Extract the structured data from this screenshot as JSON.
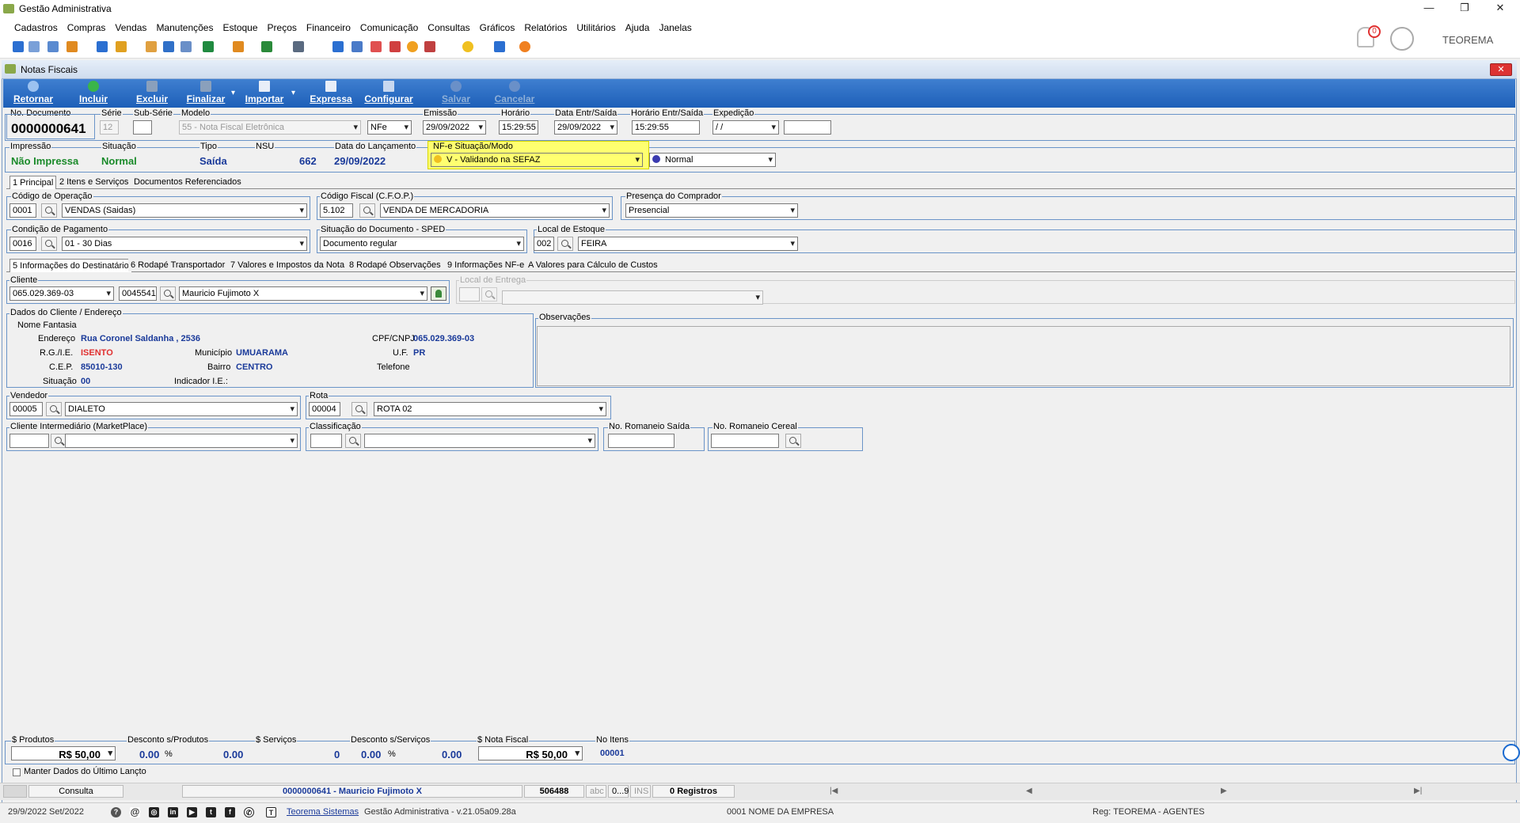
{
  "app": {
    "title": "Gestão Administrativa",
    "min": "—",
    "restore": "❐",
    "close": "✕"
  },
  "menu": [
    "Cadastros",
    "Compras",
    "Vendas",
    "Manutenções",
    "Estoque",
    "Preços",
    "Financeiro",
    "Comunicação",
    "Consultas",
    "Gráficos",
    "Relatórios",
    "Utilitários",
    "Ajuda",
    "Janelas"
  ],
  "user": {
    "name": "TEOREMA",
    "notifications": "0"
  },
  "child": {
    "title": "Notas Fiscais",
    "close": "✕"
  },
  "toolbar": {
    "retornar": "Retornar",
    "incluir": "Incluir",
    "excluir": "Excluir",
    "finalizar": "Finalizar",
    "importar": "Importar",
    "expressa": "Expressa",
    "configurar": "Configurar",
    "salvar": "Salvar",
    "cancelar": "Cancelar"
  },
  "header": {
    "no_documento_label": "No. Documento",
    "no_documento": "0000000641",
    "serie_label": "Série",
    "serie": "12",
    "subserie_label": "Sub-Série",
    "subserie": "",
    "modelo_label": "Modelo",
    "modelo": "55 - Nota Fiscal Eletrônica",
    "modelo_tipo": "NFe",
    "emissao_label": "Emissão",
    "emissao": "29/09/2022",
    "horario_label": "Horário",
    "horario": "15:29:55",
    "data_entr_label": "Data Entr/Saída",
    "data_entr": "29/09/2022",
    "horario_entr_label": "Horário Entr/Saída",
    "horario_entr": "15:29:55",
    "expedicao_label": "Expedição",
    "expedicao": " / /",
    "expedicao_hora": ""
  },
  "status": {
    "impressao_label": "Impressão",
    "impressao": "Não Impressa",
    "situacao_label": "Situação",
    "situacao": "Normal",
    "tipo_label": "Tipo",
    "tipo": "Saída",
    "nsu_label": "NSU",
    "nsu": "662",
    "data_lanc_label": "Data do Lançamento",
    "data_lanc": "29/09/2022",
    "nfe_label": "NF-e Situação/Modo",
    "nfe_situacao": "V - Validando na SEFAZ",
    "nfe_modo": "Normal"
  },
  "tabs1": [
    "1 Principal",
    "2 Itens e Serviços",
    "Documentos Referenciados"
  ],
  "principal": {
    "cod_op_label": "Código de Operação",
    "cod_op": "0001",
    "cod_op_desc": "VENDAS (Saidas)",
    "cfop_label": "Código Fiscal (C.F.O.P.)",
    "cfop": "5.102",
    "cfop_desc": "VENDA DE MERCADORIA",
    "presenca_label": "Presença do Comprador",
    "presenca": "Presencial",
    "cond_pag_label": "Condição de Pagamento",
    "cond_pag": "0016",
    "cond_pag_desc": "01 - 30 Dias",
    "sit_doc_label": "Situação do Documento - SPED",
    "sit_doc": "Documento regular",
    "local_est_label": "Local de Estoque",
    "local_est": "002",
    "local_est_desc": "FEIRA"
  },
  "tabs2": [
    "5 Informações do Destinatário",
    "6 Rodapé Transportador",
    "7 Valores e Impostos da Nota",
    "8 Rodapé Observações",
    "9 Informações NF-e",
    "A Valores para Cálculo de Custos"
  ],
  "destinatario": {
    "cliente_label": "Cliente",
    "cpf": "065.029.369-03",
    "codigo": "0045541",
    "nome": "Mauricio Fujimoto X",
    "local_entrega_label": "Local de Entrega",
    "dados_label": "Dados do Cliente / Endereço",
    "nome_fantasia_label": "Nome Fantasia",
    "endereco_label": "Endereço",
    "endereco": "Rua Coronel Saldanha , 2536",
    "cpfcnpj_label": "CPF/CNPJ",
    "cpfcnpj": "065.029.369-03",
    "rgie_label": "R.G./I.E.",
    "rgie": "ISENTO",
    "municipio_label": "Município",
    "municipio": "UMUARAMA",
    "uf_label": "U.F.",
    "uf": "PR",
    "cep_label": "C.E.P.",
    "cep": "85010-130",
    "bairro_label": "Bairro",
    "bairro": "CENTRO",
    "telefone_label": "Telefone",
    "situacao_label": "Situação",
    "situacao": "00",
    "indicador_label": "Indicador I.E.:",
    "observacoes_label": "Observações",
    "vendedor_label": "Vendedor",
    "vendedor": "00005",
    "vendedor_desc": "DIALETO",
    "rota_label": "Rota",
    "rota": "00004",
    "rota_desc": "ROTA 02",
    "intermediario_label": "Cliente Intermediário (MarketPlace)",
    "classificacao_label": "Classificação",
    "romaneio_saida_label": "No. Romaneio Saída",
    "romaneio_cereal_label": "No. Romaneio Cereal"
  },
  "totals": {
    "produtos_label": "$ Produtos",
    "produtos": "R$ 50,00",
    "desc_prod_label": "Desconto s/Produtos",
    "desc_prod_pct": "0.00",
    "desc_prod": "0.00",
    "servicos_label": "$ Serviços",
    "servicos": "0",
    "desc_serv_label": "Desconto s/Serviços",
    "desc_serv_pct": "0.00",
    "desc_serv": "0.00",
    "nota_label": "$ Nota Fiscal",
    "nota": "R$ 50,00",
    "itens_label": "No Itens",
    "itens": "00001",
    "pct": "%",
    "manter": "Manter Dados do Último Lançto"
  },
  "statusbar": {
    "consulta": "Consulta",
    "registro": "0000000641 - Mauricio Fujimoto X",
    "code": "506488",
    "abc": "abc",
    "num": "0...9",
    "ins": "INS",
    "registros": "0 Registros",
    "first": "|◀",
    "prev": "◀",
    "next": "▶",
    "last": "▶|"
  },
  "bottom": {
    "date": "29/9/2022 Set/2022",
    "company_link": "Teorema Sistemas",
    "version": "Gestão Administrativa - v.21.05a09.28a",
    "empresa": "0001 NOME DA EMPRESA",
    "reg": "Reg: TEOREMA - AGENTES"
  }
}
